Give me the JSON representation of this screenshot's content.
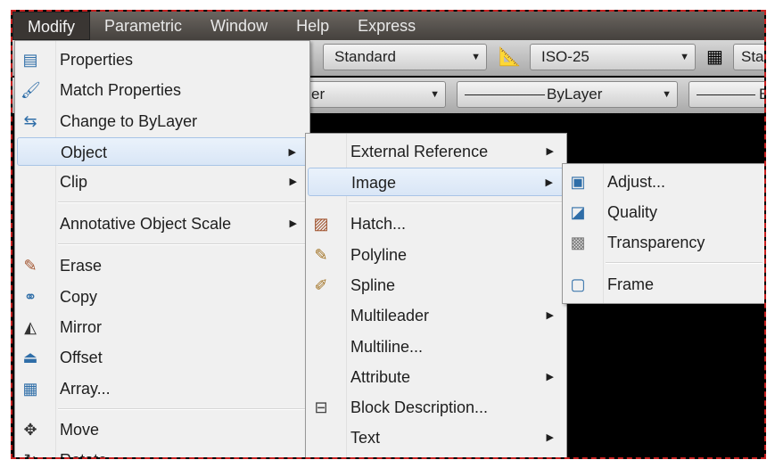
{
  "menubar": {
    "items": [
      "Modify",
      "Parametric",
      "Window",
      "Help",
      "Express"
    ],
    "active": "Modify"
  },
  "toolbar": {
    "text_style": "Standard",
    "dim_style": "ISO-25",
    "table_style": "Sta",
    "layer": "er",
    "linetype": "ByLayer",
    "lineweight": "By"
  },
  "modify_menu": {
    "items": [
      {
        "label": "Properties",
        "icon": "properties-icon"
      },
      {
        "label": "Match Properties",
        "icon": "match-properties-icon"
      },
      {
        "label": "Change to ByLayer",
        "icon": "change-bylayer-icon"
      },
      {
        "label": "Object",
        "submenu": true,
        "highlighted": true
      },
      {
        "label": "Clip",
        "submenu": true
      },
      {
        "label": "Annotative Object Scale",
        "submenu": true
      },
      {
        "label": "Erase",
        "icon": "eraser-icon"
      },
      {
        "label": "Copy",
        "icon": "copy-icon"
      },
      {
        "label": "Mirror",
        "icon": "mirror-icon"
      },
      {
        "label": "Offset",
        "icon": "offset-icon"
      },
      {
        "label": "Array...",
        "icon": "array-icon"
      },
      {
        "label": "Move",
        "icon": "move-icon"
      },
      {
        "label": "Rotate",
        "icon": "rotate-icon"
      }
    ]
  },
  "object_menu": {
    "items": [
      {
        "label": "External Reference",
        "submenu": true
      },
      {
        "label": "Image",
        "submenu": true,
        "highlighted": true
      },
      {
        "label": "Hatch...",
        "icon": "hatch-edit-icon"
      },
      {
        "label": "Polyline",
        "icon": "polyline-edit-icon"
      },
      {
        "label": "Spline",
        "icon": "spline-edit-icon"
      },
      {
        "label": "Multileader",
        "submenu": true
      },
      {
        "label": "Multiline..."
      },
      {
        "label": "Attribute",
        "submenu": true
      },
      {
        "label": "Block Description...",
        "icon": "block-description-icon"
      },
      {
        "label": "Text",
        "submenu": true
      }
    ]
  },
  "image_menu": {
    "items": [
      {
        "label": "Adjust...",
        "icon": "image-adjust-icon"
      },
      {
        "label": "Quality",
        "icon": "image-quality-icon"
      },
      {
        "label": "Transparency",
        "icon": "image-transparency-icon"
      },
      {
        "label": "Frame",
        "icon": "image-frame-icon"
      }
    ]
  }
}
